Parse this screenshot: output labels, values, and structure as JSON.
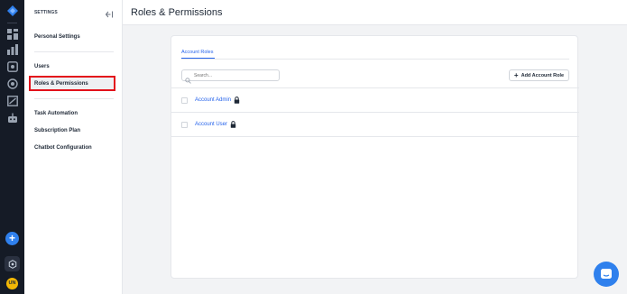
{
  "settings": {
    "title": "SETTINGS",
    "items": [
      {
        "label": "Personal Settings"
      },
      {
        "label": "Users"
      },
      {
        "label": "Roles & Permissions",
        "active": true
      },
      {
        "label": "Task Automation"
      },
      {
        "label": "Subscription Plan"
      },
      {
        "label": "Chatbot Configuration"
      }
    ]
  },
  "header": {
    "title": "Roles & Permissions"
  },
  "main": {
    "tabs": [
      {
        "label": "Account Roles",
        "active": true
      }
    ],
    "search": {
      "placeholder": "Search..."
    },
    "add_button": {
      "label": "Add Account Role"
    },
    "roles": [
      {
        "name": "Account Admin",
        "locked": true
      },
      {
        "name": "Account User",
        "locked": true
      }
    ]
  },
  "user": {
    "initials": "UN"
  },
  "colors": {
    "accent": "#2563eb",
    "rail": "#151b26",
    "highlight": "#e3121b",
    "avatar": "#f2b705"
  },
  "icons": [
    "app-logo-icon",
    "dashboard-icon",
    "analytics-icon",
    "inbox-icon",
    "contacts-icon",
    "reports-icon",
    "bot-icon",
    "plus-icon",
    "settings-hex-icon",
    "collapse-icon",
    "search-icon",
    "lock-icon",
    "chat-icon"
  ]
}
